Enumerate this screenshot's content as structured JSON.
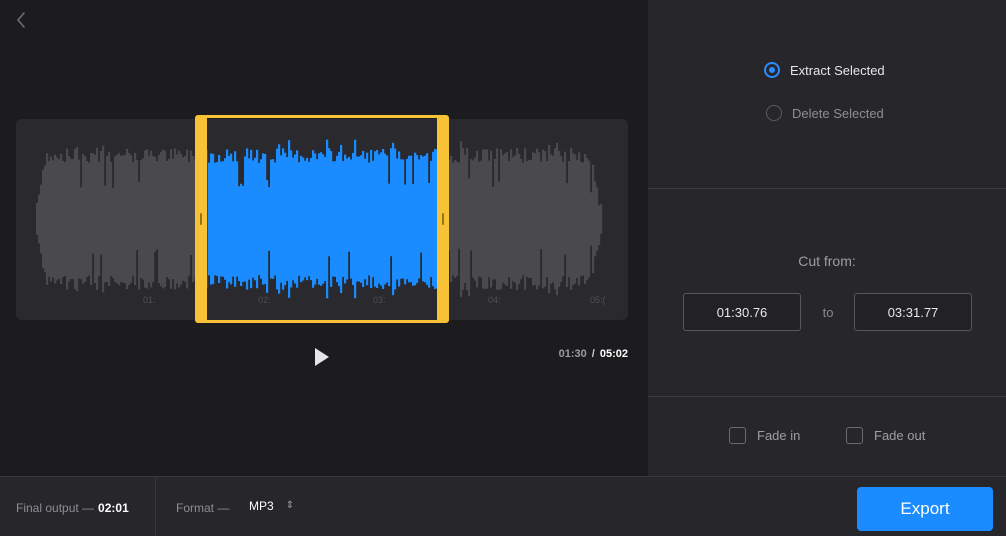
{
  "header": {
    "back_icon": "chevron-left-icon"
  },
  "waveform": {
    "timeline_labels": [
      "01:",
      "02:",
      "03:",
      "04:",
      "05:("
    ],
    "selection_color": "#1a8cff",
    "unselected_color": "#4a4a4e",
    "handle_color": "#f7c235"
  },
  "player": {
    "play_icon": "play-icon",
    "current_time": "01:30",
    "separator": "/",
    "total_time": "05:02"
  },
  "mode": {
    "options": [
      {
        "label": "Extract Selected",
        "selected": true
      },
      {
        "label": "Delete Selected",
        "selected": false
      }
    ]
  },
  "cut": {
    "label": "Cut from:",
    "start": "01:30.76",
    "to_label": "to",
    "end": "03:31.77"
  },
  "fades": {
    "fade_in": {
      "label": "Fade in",
      "checked": false
    },
    "fade_out": {
      "label": "Fade out",
      "checked": false
    }
  },
  "footer": {
    "final_output_label": "Final output —",
    "final_output_value": "02:01",
    "format_label": "Format —",
    "format_value": "MP3",
    "format_icon": "updown-arrows-icon",
    "export_label": "Export"
  },
  "colors": {
    "accent": "#1a8cff",
    "selection_border": "#f7c235"
  }
}
